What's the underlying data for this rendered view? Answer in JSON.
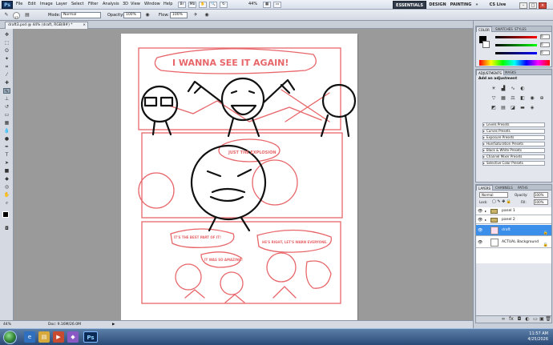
{
  "app": {
    "logo": "Ps"
  },
  "menubar": {
    "items": [
      "File",
      "Edit",
      "Image",
      "Layer",
      "Select",
      "Filter",
      "Analysis",
      "3D",
      "View",
      "Window",
      "Help"
    ],
    "zoom": "44%",
    "workspaces": [
      "ESSENTIALS",
      "DESIGN",
      "PAINTING"
    ],
    "more": "»",
    "cs_live": "CS Live"
  },
  "options": {
    "brush_size": "17",
    "mode_label": "Mode:",
    "mode_value": "Normal",
    "opacity_label": "Opacity:",
    "opacity_value": "100%",
    "flow_label": "Flow:",
    "flow_value": "100%"
  },
  "document": {
    "tab_title": "draft3.psd @ 44% (draft, RGB/8#) *"
  },
  "comic": {
    "bubble_1": "I WANNA SEE IT AGAIN!",
    "bubble_2": "JUST THE EXPLOSION",
    "bubble_3": "IT'S THE BEST PART OF IT!",
    "bubble_4": "HE'S RIGHT, LET'S WARN EVERYONE.",
    "bubble_5": "IT WAS SO AMAZING!"
  },
  "status": {
    "zoom": "44%",
    "doc_size": "Doc: 9.16M/26.0M"
  },
  "color_panel": {
    "tabs": [
      "COLOR",
      "SWATCHES",
      "STYLES"
    ],
    "slider_values": [
      "0",
      "0",
      "0"
    ]
  },
  "adjustments_panel": {
    "tabs": [
      "ADJUSTMENTS",
      "MASKS"
    ],
    "heading": "Add an adjustment",
    "presets": [
      "Levels Presets",
      "Curves Presets",
      "Exposure Presets",
      "Hue/Saturation Presets",
      "Black & White Presets",
      "Channel Mixer Presets",
      "Selective Color Presets"
    ]
  },
  "layers_panel": {
    "tabs": [
      "LAYERS",
      "CHANNELS",
      "PATHS"
    ],
    "blend_mode": "Normal",
    "opacity_label": "Opacity:",
    "opacity_value": "100%",
    "lock_label": "Lock:",
    "fill_label": "Fill:",
    "fill_value": "100%",
    "layers": [
      {
        "name": "panel 1",
        "type": "group",
        "selected": false
      },
      {
        "name": "panel 2",
        "type": "group",
        "selected": false
      },
      {
        "name": "draft",
        "type": "layer",
        "selected": true
      },
      {
        "name": "ACTUAL Background",
        "type": "layer",
        "selected": false
      }
    ]
  },
  "taskbar": {
    "time": "11:57 AM",
    "date": "4/25/2026",
    "app_label": "Ps"
  },
  "colors": {
    "accent": "#3b8eea",
    "sketch_red": "#e8666a",
    "panel_bg": "#e3e7ed"
  }
}
